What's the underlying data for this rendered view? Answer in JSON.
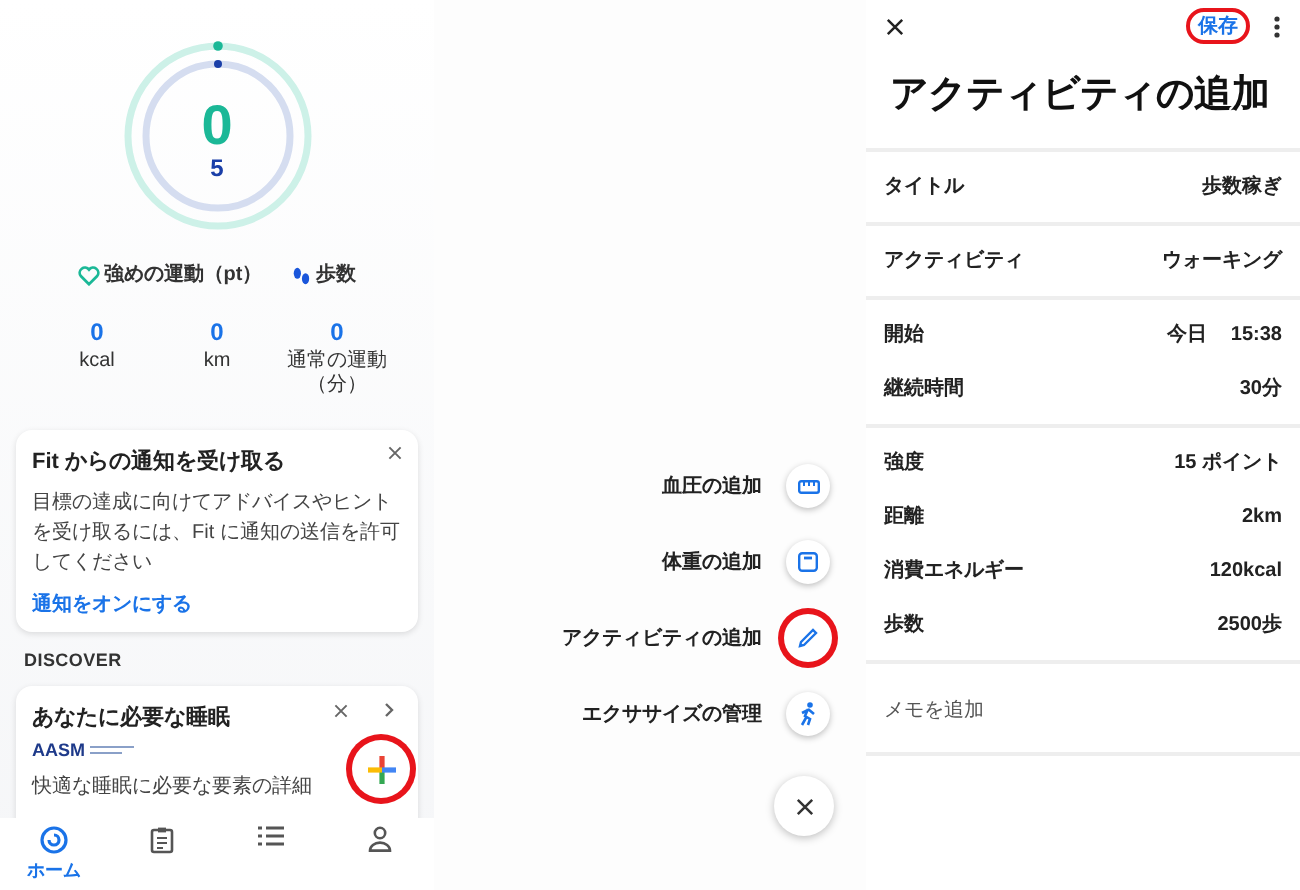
{
  "home": {
    "ring": {
      "move_value": "0",
      "steps_value": "5"
    },
    "legend": [
      {
        "kind": "heart",
        "label": "強めの運動（pt）"
      },
      {
        "kind": "steps",
        "label": "歩数"
      }
    ],
    "stats": [
      {
        "value": "0",
        "label": "kcal"
      },
      {
        "value": "0",
        "label": "km"
      },
      {
        "value": "0",
        "label": "通常の運動（分）"
      }
    ],
    "notification_card": {
      "title": "Fit からの通知を受け取る",
      "body": "目標の達成に向けてアドバイスやヒントを受け取るには、Fit に通知の送信を許可してください",
      "link": "通知をオンにする"
    },
    "section_heading": "DISCOVER",
    "discover_card": {
      "title": "あなたに必要な睡眠",
      "logo": "AASM",
      "body": "快適な睡眠に必要な要素の詳細"
    },
    "fab": {
      "highlighted": true
    },
    "nav": [
      {
        "kind": "home",
        "label": "ホーム",
        "selected": true
      },
      {
        "kind": "journal",
        "selected": false
      },
      {
        "kind": "browse",
        "selected": false
      },
      {
        "kind": "profile",
        "selected": false
      }
    ]
  },
  "fab_menu": {
    "items": [
      {
        "label": "血圧の追加",
        "kind": "blood-pressure",
        "highlighted": false
      },
      {
        "label": "体重の追加",
        "kind": "weight",
        "highlighted": false
      },
      {
        "label": "アクティビティの追加",
        "kind": "activity",
        "highlighted": true
      },
      {
        "label": "エクササイズの管理",
        "kind": "exercise",
        "highlighted": false
      }
    ]
  },
  "add_activity": {
    "save_label": "保存",
    "save_highlighted": true,
    "title": "アクティビティの追加",
    "sections": [
      {
        "rows": [
          {
            "label": "タイトル",
            "values": [
              "歩数稼ぎ"
            ]
          }
        ]
      },
      {
        "rows": [
          {
            "label": "アクティビティ",
            "values": [
              "ウォーキング"
            ]
          }
        ]
      },
      {
        "rows": [
          {
            "label": "開始",
            "values": [
              "今日",
              "15:38"
            ]
          },
          {
            "label": "継続時間",
            "values": [
              "30分"
            ]
          }
        ]
      },
      {
        "rows": [
          {
            "label": "強度",
            "values": [
              "15 ポイント"
            ]
          },
          {
            "label": "距離",
            "values": [
              "2km"
            ]
          },
          {
            "label": "消費エネルギー",
            "values": [
              "120kcal"
            ]
          },
          {
            "label": "歩数",
            "values": [
              "2500歩"
            ]
          }
        ]
      }
    ],
    "memo_placeholder": "メモを追加"
  }
}
